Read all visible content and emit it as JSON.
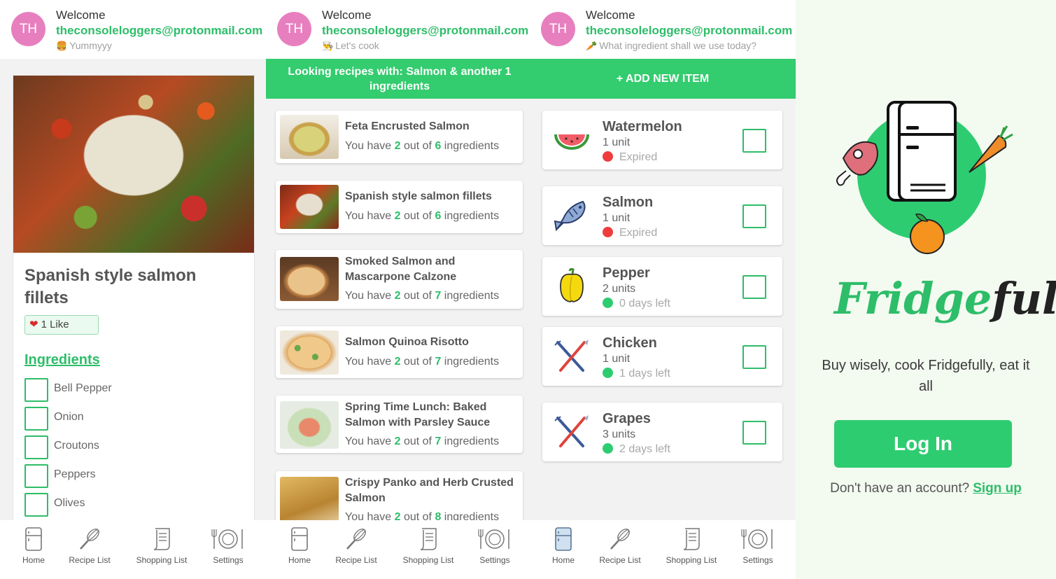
{
  "user": {
    "avatar_initials": "TH",
    "welcome": "Welcome",
    "email": "theconsoleloggers@protonmail.com"
  },
  "screens": [
    {
      "subtitle": "Yummyyy",
      "subtitle_icon": "burger-icon"
    },
    {
      "subtitle": "Let's cook",
      "subtitle_icon": "chef-icon"
    },
    {
      "subtitle": "What ingredient shall we use today?",
      "subtitle_icon": "carrot-icon"
    }
  ],
  "nav": {
    "items": [
      {
        "label": "Home",
        "icon": "fridge-icon"
      },
      {
        "label": "Recipe List",
        "icon": "whisk-icon"
      },
      {
        "label": "Shopping List",
        "icon": "list-icon"
      },
      {
        "label": "Settings",
        "icon": "dinner-plate-icon"
      }
    ]
  },
  "recipe_detail": {
    "title": "Spanish style salmon fillets",
    "likes": "1 Like",
    "ingredients_heading": "Ingredients",
    "ingredients": [
      "Bell Pepper",
      "Onion",
      "Croutons",
      "Peppers",
      "Olives"
    ]
  },
  "recipe_list": {
    "banner": "Looking recipes with: Salmon & another 1 ingredients",
    "have_prefix": "You have",
    "have_middle": "out of",
    "have_suffix": "ingredients",
    "recipes": [
      {
        "name": "Feta Encrusted Salmon",
        "have": "2",
        "total": "6"
      },
      {
        "name": "Spanish style salmon fillets",
        "have": "2",
        "total": "6"
      },
      {
        "name": "Smoked Salmon and Mascarpone Calzone",
        "have": "2",
        "total": "7"
      },
      {
        "name": "Salmon Quinoa Risotto",
        "have": "2",
        "total": "7"
      },
      {
        "name": "Spring Time Lunch: Baked Salmon with Parsley Sauce",
        "have": "2",
        "total": "7"
      },
      {
        "name": "Crispy Panko and Herb Crusted Salmon",
        "have": "2",
        "total": "8"
      }
    ]
  },
  "fridge": {
    "add_button": "+ ADD NEW ITEM",
    "items": [
      {
        "name": "Watermelon",
        "qty": "1 unit",
        "status": "Expired",
        "status_color": "#f03c3c",
        "icon": "watermelon-icon"
      },
      {
        "name": "Salmon",
        "qty": "1 unit",
        "status": "Expired",
        "status_color": "#f03c3c",
        "icon": "fish-icon"
      },
      {
        "name": "Pepper",
        "qty": "2 units",
        "status": "0 days left",
        "status_color": "#2ecc71",
        "icon": "bell-pepper-icon"
      },
      {
        "name": "Chicken",
        "qty": "1 unit",
        "status": "1 days left",
        "status_color": "#2ecc71",
        "icon": "fork-knife-icon"
      },
      {
        "name": "Grapes",
        "qty": "3 units",
        "status": "2 days left",
        "status_color": "#2ecc71",
        "icon": "fork-knife-icon"
      }
    ]
  },
  "login": {
    "brand_part1": "Fridge",
    "brand_part2": "ful",
    "tagline": "Buy wisely, cook Fridgefully, eat it all",
    "login_button": "Log In",
    "no_account": "Don't have an account?",
    "sign_up": "Sign up"
  },
  "colors": {
    "accent": "#2ecc71",
    "avatar": "#e77fbf",
    "expired": "#f03c3c"
  }
}
